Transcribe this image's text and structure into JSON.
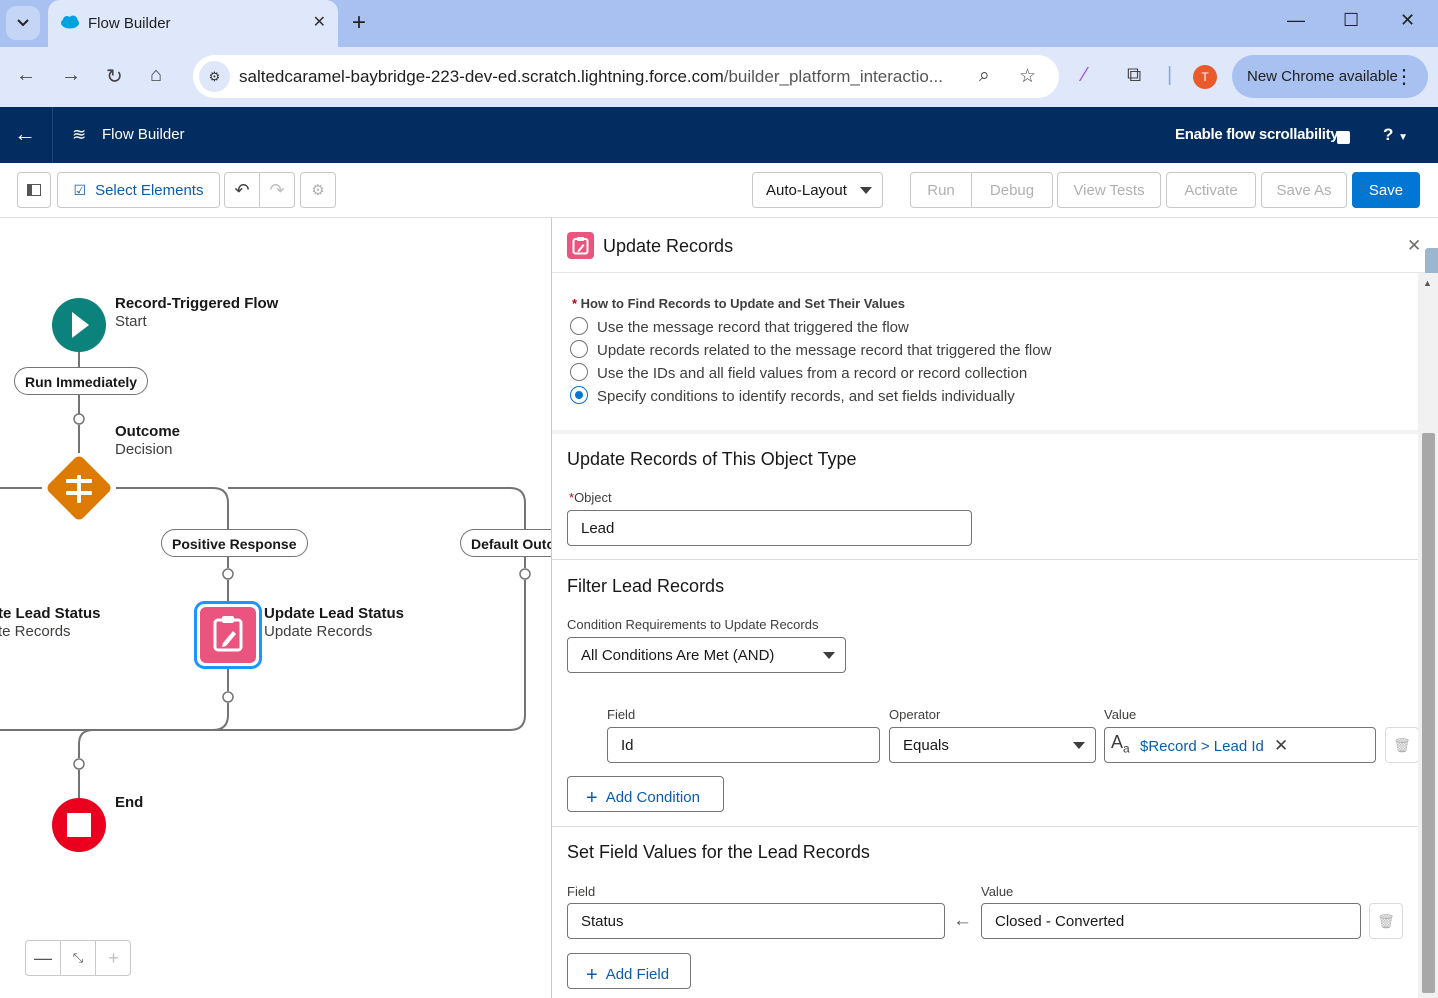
{
  "browser": {
    "tab_title": "Flow Builder",
    "url_host": "saltedcaramel-baybridge-223-dev-ed.scratch.lightning.force.com",
    "url_path": "/builder_platform_interactio...",
    "profile_initial": "T",
    "update_label": "New Chrome available"
  },
  "app": {
    "title": "Flow Builder",
    "scrollability_label": "Enable flow scrollability",
    "help_label": "?"
  },
  "toolbar": {
    "select_elements": "Select Elements",
    "layout": "Auto-Layout",
    "run": "Run",
    "debug": "Debug",
    "view_tests": "View Tests",
    "activate": "Activate",
    "save_as": "Save As",
    "save": "Save"
  },
  "canvas": {
    "start": {
      "title": "Record-Triggered Flow",
      "subtitle": "Start"
    },
    "run_immediately": "Run Immediately",
    "decision": {
      "title": "Outcome",
      "subtitle": "Decision"
    },
    "positive_response": "Positive Response",
    "default_outcome": "Default Outc",
    "left_update": {
      "title": "te Lead Status",
      "subtitle": "te Records"
    },
    "update": {
      "title": "Update Lead Status",
      "subtitle": "Update Records"
    },
    "end": {
      "title": "End"
    }
  },
  "panel": {
    "title": "Update Records",
    "how_label": "How to Find Records to Update and Set Their Values",
    "radio_options": [
      "Use the message record that triggered the flow",
      "Update records related to the message record that triggered the flow",
      "Use the IDs and all field values from a record or record collection",
      "Specify conditions to identify records, and set fields individually"
    ],
    "selected_option": 3,
    "object_section": {
      "title": "Update Records of This Object Type",
      "object_label": "Object",
      "object_value": "Lead"
    },
    "filter_section": {
      "title": "Filter Lead Records",
      "requirements_label": "Condition Requirements to Update Records",
      "requirements_value": "All Conditions Are Met (AND)",
      "field_label": "Field",
      "operator_label": "Operator",
      "value_label": "Value",
      "condition": {
        "field": "Id",
        "operator": "Equals",
        "value": "$Record > Lead Id"
      },
      "add_condition": "Add Condition"
    },
    "set_section": {
      "title": "Set Field Values for the Lead Records",
      "field_label": "Field",
      "value_label": "Value",
      "assignment": {
        "field": "Status",
        "value": "Closed - Converted"
      },
      "add_field": "Add Field"
    }
  },
  "colors": {
    "header_navy": "#032d60",
    "brand_blue": "#0176d3",
    "start_green": "#0b827c",
    "decision_orange": "#dd7a01",
    "update_pink": "#ec5480",
    "end_red": "#ea001e"
  }
}
